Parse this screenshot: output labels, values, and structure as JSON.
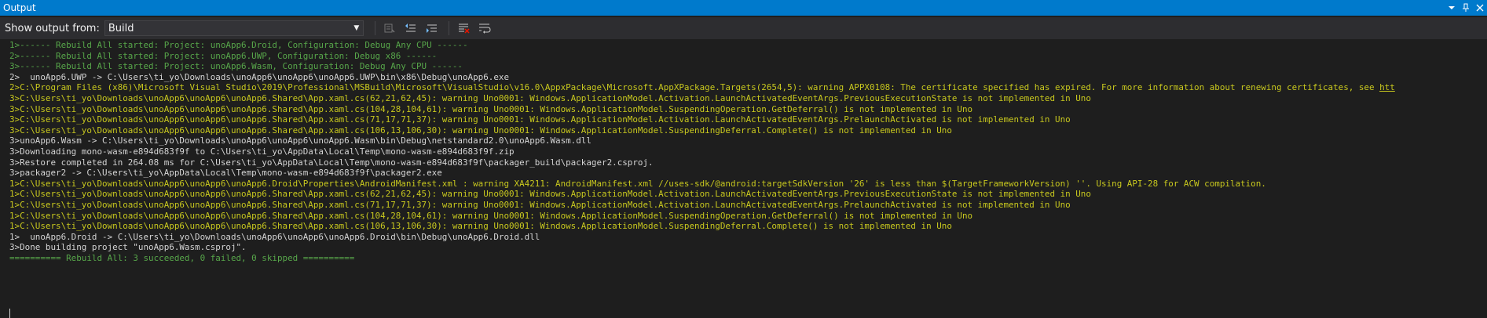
{
  "window": {
    "title": "Output"
  },
  "toolbar": {
    "show_output_label": "Show output from:",
    "source_value": "Build"
  },
  "colors": {
    "title_bar": "#007acc",
    "background": "#1e1e1e",
    "success_green": "#57a64a",
    "warning_yellow": "#c8c81e",
    "normal_text": "#d4d4d4"
  },
  "lines": [
    {
      "text": "1>------ Rebuild All started: Project: unoApp6.Droid, Configuration: Debug Any CPU ------",
      "kind": "green"
    },
    {
      "text": "2>------ Rebuild All started: Project: unoApp6.UWP, Configuration: Debug x86 ------",
      "kind": "green"
    },
    {
      "text": "3>------ Rebuild All started: Project: unoApp6.Wasm, Configuration: Debug Any CPU ------",
      "kind": "green"
    },
    {
      "text": "2>  unoApp6.UWP -> C:\\Users\\ti_yo\\Downloads\\unoApp6\\unoApp6\\unoApp6.UWP\\bin\\x86\\Debug\\unoApp6.exe",
      "kind": "info"
    },
    {
      "text": "2>C:\\Program Files (x86)\\Microsoft Visual Studio\\2019\\Professional\\MSBuild\\Microsoft\\VisualStudio\\v16.0\\AppxPackage\\Microsoft.AppXPackage.Targets(2654,5): warning APPX0108: The certificate specified has expired. For more information about renewing certificates, see ",
      "kind": "warn",
      "link": "htt"
    },
    {
      "text": "3>C:\\Users\\ti_yo\\Downloads\\unoApp6\\unoApp6\\unoApp6.Shared\\App.xaml.cs(62,21,62,45): warning Uno0001: Windows.ApplicationModel.Activation.LaunchActivatedEventArgs.PreviousExecutionState is not implemented in Uno",
      "kind": "warn"
    },
    {
      "text": "3>C:\\Users\\ti_yo\\Downloads\\unoApp6\\unoApp6\\unoApp6.Shared\\App.xaml.cs(104,28,104,61): warning Uno0001: Windows.ApplicationModel.SuspendingOperation.GetDeferral() is not implemented in Uno",
      "kind": "warn"
    },
    {
      "text": "3>C:\\Users\\ti_yo\\Downloads\\unoApp6\\unoApp6\\unoApp6.Shared\\App.xaml.cs(71,17,71,37): warning Uno0001: Windows.ApplicationModel.Activation.LaunchActivatedEventArgs.PrelaunchActivated is not implemented in Uno",
      "kind": "warn"
    },
    {
      "text": "3>C:\\Users\\ti_yo\\Downloads\\unoApp6\\unoApp6\\unoApp6.Shared\\App.xaml.cs(106,13,106,30): warning Uno0001: Windows.ApplicationModel.SuspendingDeferral.Complete() is not implemented in Uno",
      "kind": "warn"
    },
    {
      "text": "3>unoApp6.Wasm -> C:\\Users\\ti_yo\\Downloads\\unoApp6\\unoApp6\\unoApp6.Wasm\\bin\\Debug\\netstandard2.0\\unoApp6.Wasm.dll",
      "kind": "info"
    },
    {
      "text": "3>Downloading mono-wasm-e894d683f9f to C:\\Users\\ti_yo\\AppData\\Local\\Temp\\mono-wasm-e894d683f9f.zip",
      "kind": "info"
    },
    {
      "text": "3>Restore completed in 264.08 ms for C:\\Users\\ti_yo\\AppData\\Local\\Temp\\mono-wasm-e894d683f9f\\packager_build\\packager2.csproj.",
      "kind": "info"
    },
    {
      "text": "3>packager2 -> C:\\Users\\ti_yo\\AppData\\Local\\Temp\\mono-wasm-e894d683f9f\\packager2.exe",
      "kind": "info"
    },
    {
      "text": "1>C:\\Users\\ti_yo\\Downloads\\unoApp6\\unoApp6\\unoApp6.Droid\\Properties\\AndroidManifest.xml : warning XA4211: AndroidManifest.xml //uses-sdk/@android:targetSdkVersion '26' is less than $(TargetFrameworkVersion) ''. Using API-28 for ACW compilation.",
      "kind": "warn"
    },
    {
      "text": "1>C:\\Users\\ti_yo\\Downloads\\unoApp6\\unoApp6\\unoApp6.Shared\\App.xaml.cs(62,21,62,45): warning Uno0001: Windows.ApplicationModel.Activation.LaunchActivatedEventArgs.PreviousExecutionState is not implemented in Uno",
      "kind": "warn"
    },
    {
      "text": "1>C:\\Users\\ti_yo\\Downloads\\unoApp6\\unoApp6\\unoApp6.Shared\\App.xaml.cs(71,17,71,37): warning Uno0001: Windows.ApplicationModel.Activation.LaunchActivatedEventArgs.PrelaunchActivated is not implemented in Uno",
      "kind": "warn"
    },
    {
      "text": "1>C:\\Users\\ti_yo\\Downloads\\unoApp6\\unoApp6\\unoApp6.Shared\\App.xaml.cs(104,28,104,61): warning Uno0001: Windows.ApplicationModel.SuspendingOperation.GetDeferral() is not implemented in Uno",
      "kind": "warn"
    },
    {
      "text": "1>C:\\Users\\ti_yo\\Downloads\\unoApp6\\unoApp6\\unoApp6.Shared\\App.xaml.cs(106,13,106,30): warning Uno0001: Windows.ApplicationModel.SuspendingDeferral.Complete() is not implemented in Uno",
      "kind": "warn"
    },
    {
      "text": "1>  unoApp6.Droid -> C:\\Users\\ti_yo\\Downloads\\unoApp6\\unoApp6\\unoApp6.Droid\\bin\\Debug\\unoApp6.Droid.dll",
      "kind": "info"
    },
    {
      "text": "3>Done building project \"unoApp6.Wasm.csproj\".",
      "kind": "info"
    },
    {
      "text": "========== Rebuild All: 3 succeeded, 0 failed, 0 skipped ==========",
      "kind": "green"
    }
  ]
}
